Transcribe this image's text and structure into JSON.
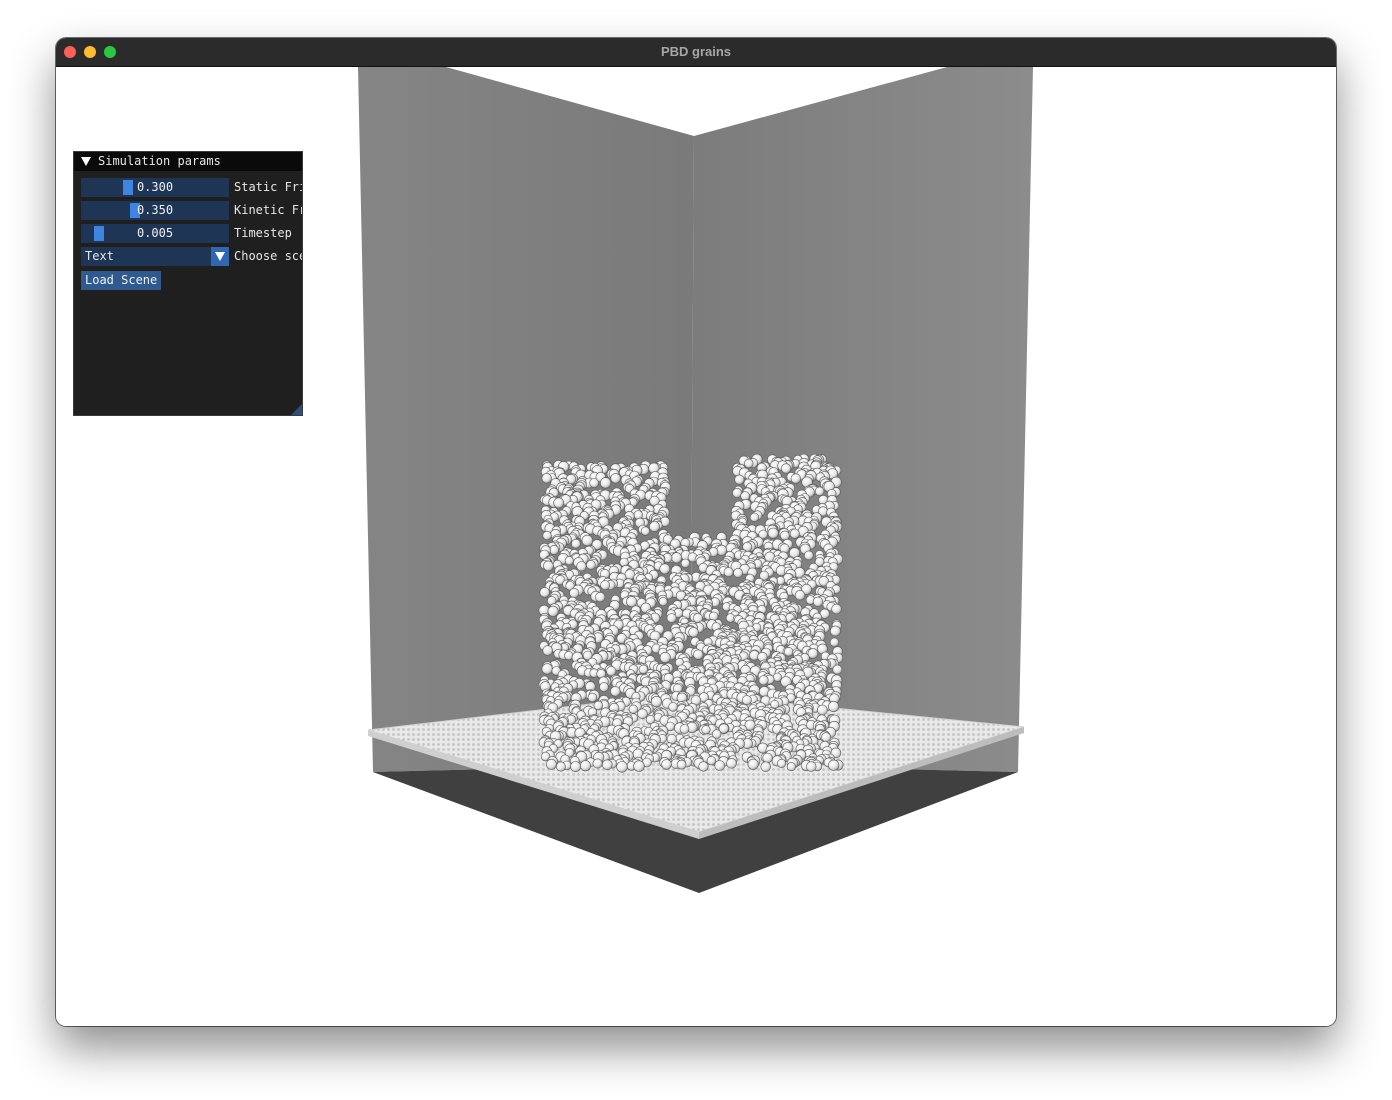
{
  "window": {
    "title": "PBD grains"
  },
  "panel": {
    "title": "Simulation params",
    "static_friction": {
      "value": "0.300",
      "fraction": 0.3,
      "label": "Static Friction"
    },
    "kinetic_friction": {
      "value": "0.350",
      "fraction": 0.35,
      "label": "Kinetic Friction"
    },
    "timestep": {
      "value": "0.005",
      "fraction": 0.08,
      "label": "Timestep"
    },
    "scene_combo": {
      "selected": "Text",
      "label": "Choose scene"
    },
    "load_button": "Load Scene"
  },
  "colors": {
    "wall_left": "#7f7f7f",
    "wall_right": "#898989",
    "floor_shadow": "#404040",
    "grain": "#f2f2f2",
    "slider_grab": "#3d85e0",
    "slider_bg": "#1e3556",
    "panel_bg": "#1f1f1f"
  }
}
